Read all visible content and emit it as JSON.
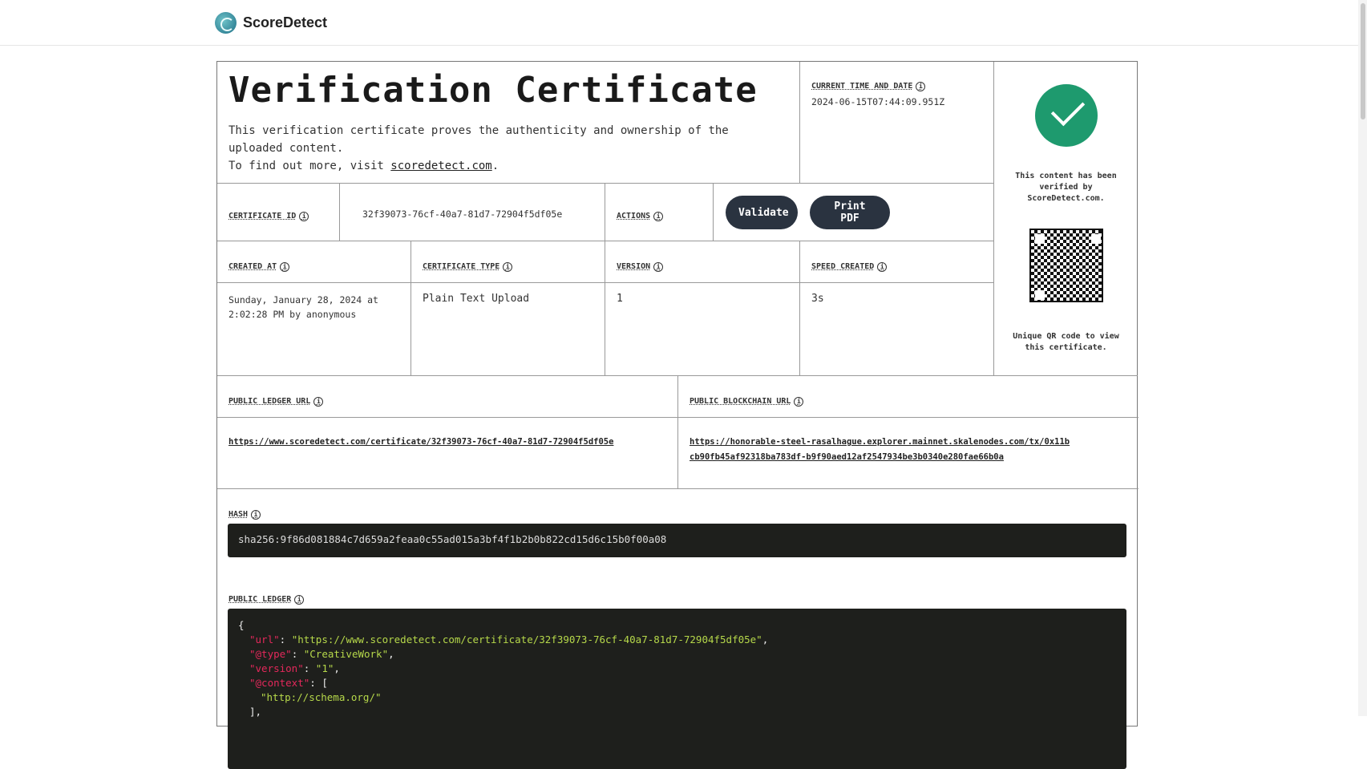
{
  "app": {
    "name": "ScoreDetect"
  },
  "certificate": {
    "title": "Verification Certificate",
    "description_line1": "This verification certificate proves the authenticity and ownership of the uploaded content.",
    "description_prefix": "To find out more, visit ",
    "description_link": "scoredetect.com",
    "description_suffix": ".",
    "current_time_label": "CURRENT TIME AND DATE",
    "current_time": "2024-06-15T07:44:09.951Z",
    "certificate_id_label": "CERTIFICATE ID",
    "certificate_id": "32f39073-76cf-40a7-81d7-72904f5df05e",
    "actions_label": "ACTIONS",
    "validate_label": "Validate",
    "print_label": "Print PDF",
    "created_at_label": "CREATED AT",
    "created_at": "Sunday, January 28, 2024 at 2:02:28 PM by anonymous",
    "type_label": "CERTIFICATE TYPE",
    "type": "Plain Text Upload",
    "version_label": "VERSION",
    "version": "1",
    "speed_label": "SPEED CREATED",
    "speed": "3s",
    "ledger_url_label": "PUBLIC LEDGER URL",
    "ledger_url": "https://www.scoredetect.com/certificate/32f39073-76cf-40a7-81d7-72904f5df05e",
    "blockchain_url_label": "PUBLIC BLOCKCHAIN URL",
    "blockchain_url": "https://honorable-steel-rasalhague.explorer.mainnet.skalenodes.com/tx/0x11bcb90fb45af92318ba783df-b9f90aed12af2547934be3b0340e280fae66b0a",
    "hash_label": "HASH",
    "hash": "sha256:9f86d081884c7d659a2feaa0c55ad015a3bf4f1b2b0b822cd15d6c15b0f00a08",
    "public_ledger_label": "PUBLIC LEDGER",
    "verified_text": "This content has been verified by ScoreDetect.com.",
    "qr_text": "Unique QR code to view this certificate.",
    "info_glyph": "i"
  },
  "ledger_json": {
    "open": "{",
    "url_key": "\"url\"",
    "url_val": "\"https://www.scoredetect.com/certificate/32f39073-76cf-40a7-81d7-72904f5df05e\"",
    "type_key": "\"@type\"",
    "type_val": "\"CreativeWork\"",
    "version_key": "\"version\"",
    "version_val": "\"1\"",
    "context_key": "\"@context\"",
    "context_open": "[",
    "context_item": "\"http://schema.org/\"",
    "context_close": "],"
  }
}
